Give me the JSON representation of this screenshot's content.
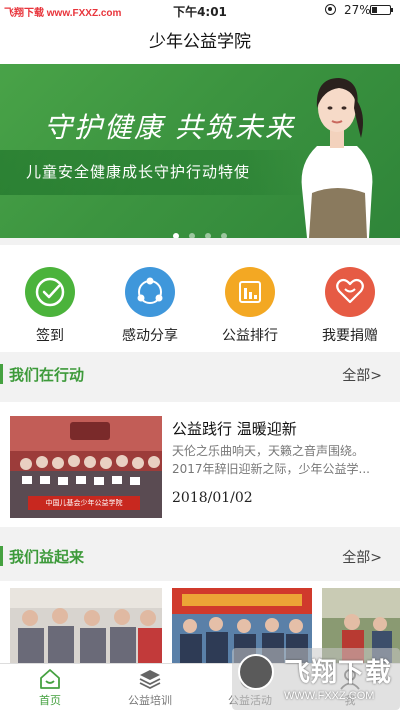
{
  "status_bar": {
    "watermark": "飞翔下载 www.FXXZ.com",
    "time": "下午4:01",
    "battery": "27%"
  },
  "nav": {
    "title": "少年公益学院"
  },
  "banner": {
    "headline": "守护健康 共筑未来",
    "subtitle": "儿童安全健康成长守护行动特使",
    "slides": 4,
    "active_slide": 0
  },
  "quick_actions": [
    {
      "label": "签到",
      "icon": "check-in-icon",
      "color": "#4bb33b"
    },
    {
      "label": "感动分享",
      "icon": "share-icon",
      "color": "#3f97db"
    },
    {
      "label": "公益排行",
      "icon": "ranking-icon",
      "color": "#f3a823"
    },
    {
      "label": "我要捐赠",
      "icon": "heart-icon",
      "color": "#e65b44"
    }
  ],
  "section_action": {
    "title": "我们在行动",
    "more": "全部>"
  },
  "news": {
    "title": "公益践行 温暖迎新",
    "desc": "天伦之乐曲响天，天籁之音声围绕。2017年辞旧迎新之际，少年公益学...",
    "date": "2018/01/02",
    "banner_text": "中国儿基会少年公益学院"
  },
  "section_photos": {
    "title": "我们益起来",
    "more": "全部>"
  },
  "tabs": [
    {
      "label": "首页",
      "icon": "home-icon",
      "active": true
    },
    {
      "label": "公益培训",
      "icon": "layers-icon",
      "active": false
    },
    {
      "label": "公益活动",
      "icon": "activity-icon",
      "active": false
    },
    {
      "label": "我",
      "icon": "profile-icon",
      "active": false
    }
  ],
  "watermark_overlay": {
    "name": "飞翔下载",
    "url": "WWW.FXXZ.COM"
  },
  "colors": {
    "brand_green": "#45a140",
    "banner_green": "#3c9440"
  }
}
